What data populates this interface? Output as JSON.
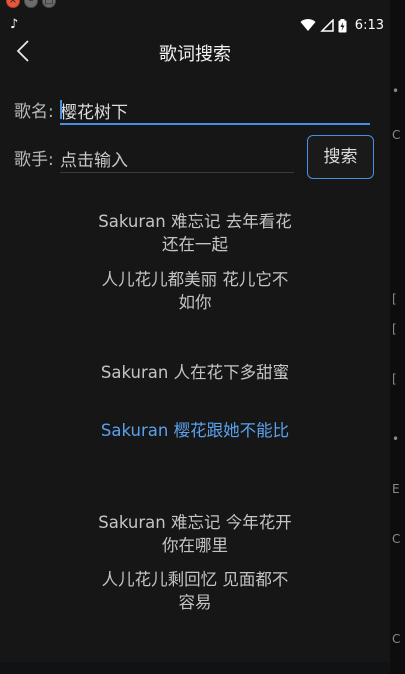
{
  "status": {
    "time": "6:13",
    "icons": [
      "music-note-icon",
      "wifi-icon",
      "signal-icon",
      "battery-charging-icon"
    ]
  },
  "header": {
    "title": "歌词搜索",
    "back_icon": "chevron-left-icon"
  },
  "form": {
    "name_label": "歌名:",
    "name_value": "樱花树下",
    "singer_label": "歌手:",
    "singer_placeholder": "点击输入",
    "search_button": "搜索"
  },
  "lyrics": [
    {
      "text": "Sakuran 难忘记 去年看花还在一起",
      "active": false
    },
    {
      "text": "人儿花儿都美丽 花儿它不如你",
      "active": false
    },
    {
      "text": "Sakuran 人在花下多甜蜜",
      "active": false
    },
    {
      "text": "Sakuran 樱花跟她不能比",
      "active": true
    },
    {
      "text": "Sakuran 难忘记 今年花开 你在哪里",
      "active": false
    },
    {
      "text": "人儿花儿剩回忆 见面都不容易",
      "active": false
    }
  ],
  "colors": {
    "accent": "#4a90e2",
    "active_lyric": "#5aa0ec",
    "background": "#161616"
  }
}
